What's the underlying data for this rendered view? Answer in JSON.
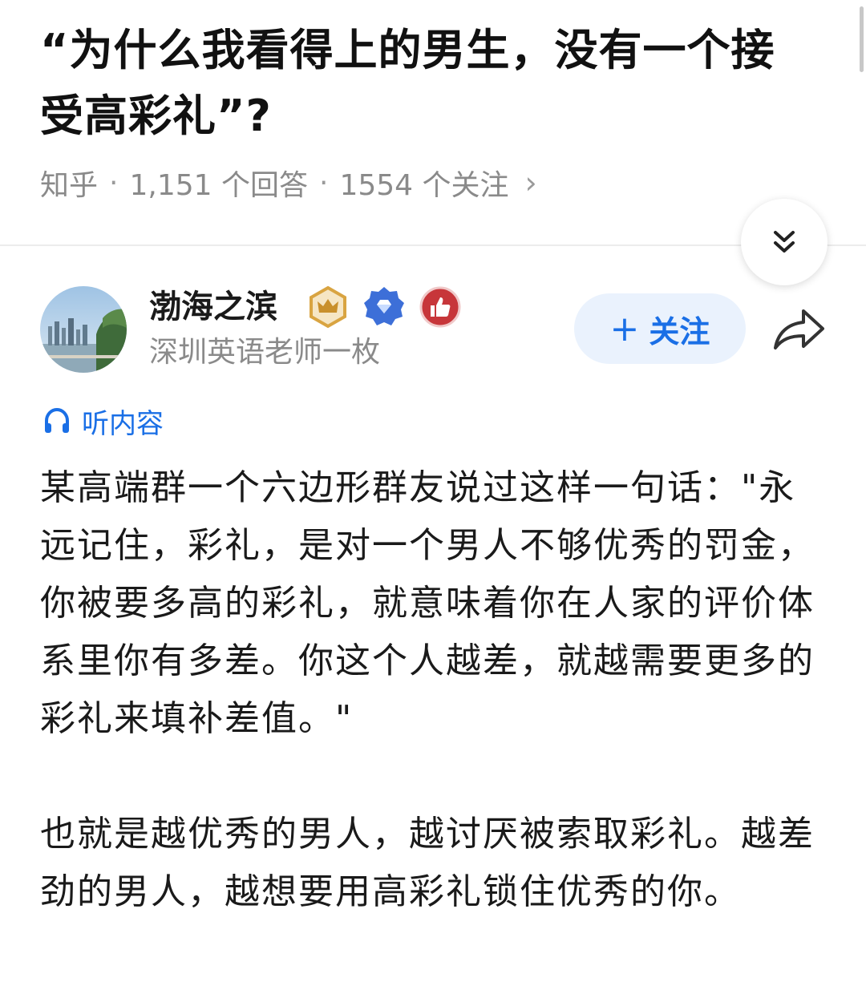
{
  "question": {
    "title": "“为什么我看得上的男生，没有一个接受高彩礼”?",
    "source": "知乎",
    "answers": "1,151 个回答",
    "follows": "1554 个关注",
    "separator": "·"
  },
  "author": {
    "name": "渤海之滨",
    "bio": "深圳英语老师一枚",
    "follow_label": "关注",
    "follow_plus": "+"
  },
  "icons": {
    "collapse": "double-chevron-down-icon",
    "share": "share-arrow-icon",
    "listen": "headphones-icon",
    "badges": [
      "crown-badge-icon",
      "blue-diamond-badge-icon",
      "thumbs-up-badge-icon"
    ]
  },
  "listen": {
    "label": "听内容"
  },
  "answer": {
    "paragraphs": [
      "某高端群一个六边形群友说过这样一句话：\"永远记住，彩礼，是对一个男人不够优秀的罚金，你被要多高的彩礼，就意味着你在人家的评价体系里你有多差。你这个人越差，就越需要更多的彩礼来填补差值。\"",
      "也就是越优秀的男人，越讨厌被索取彩礼。越差劲的男人，越想要用高彩礼锁住优秀的你。"
    ]
  },
  "colors": {
    "accent": "#1a6fe6",
    "follow_bg": "#eaf2fd",
    "meta_gray": "#8a8a8a"
  }
}
